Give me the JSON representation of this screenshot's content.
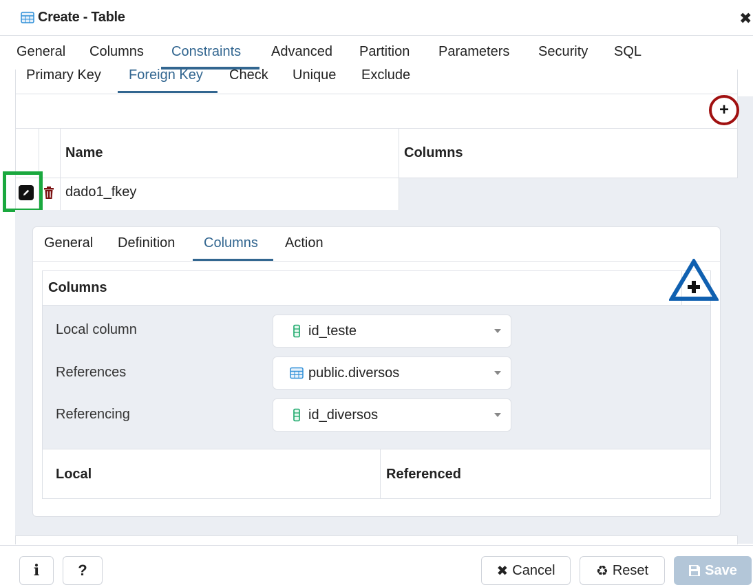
{
  "window": {
    "title": "Create - Table",
    "close_glyph": "✖"
  },
  "main_tabs": [
    {
      "label": "General"
    },
    {
      "label": "Columns"
    },
    {
      "label": "Constraints",
      "active": true
    },
    {
      "label": "Advanced"
    },
    {
      "label": "Partition"
    },
    {
      "label": "Parameters"
    },
    {
      "label": "Security"
    },
    {
      "label": "SQL"
    }
  ],
  "constraint_tabs": [
    {
      "label": "Primary Key"
    },
    {
      "label": "Foreign Key",
      "active": true
    },
    {
      "label": "Check"
    },
    {
      "label": "Unique"
    },
    {
      "label": "Exclude"
    }
  ],
  "fk_table": {
    "add_glyph": "+",
    "headers": {
      "name": "Name",
      "columns": "Columns"
    },
    "rows": [
      {
        "name": "dado1_fkey",
        "columns": ""
      }
    ]
  },
  "fk_editor": {
    "tabs": [
      {
        "label": "General"
      },
      {
        "label": "Definition"
      },
      {
        "label": "Columns",
        "active": true
      },
      {
        "label": "Action"
      }
    ],
    "columns_section": {
      "title": "Columns",
      "add_glyph": "+",
      "fields": {
        "local_column": {
          "label": "Local column",
          "value": "id_teste",
          "icon": "column-icon"
        },
        "references": {
          "label": "References",
          "value": "public.diversos",
          "icon": "table-icon"
        },
        "referencing": {
          "label": "Referencing",
          "value": "id_diversos",
          "icon": "column-icon"
        }
      },
      "table_headers": {
        "local": "Local",
        "referenced": "Referenced"
      }
    }
  },
  "footer": {
    "info_label": "i",
    "help_label": "?",
    "cancel_label": "Cancel",
    "cancel_glyph": "✖",
    "reset_label": "Reset",
    "reset_glyph": "♻",
    "save_label": "Save",
    "save_enabled": false
  },
  "colors": {
    "accent": "#326690",
    "highlight_red": "#a01010",
    "highlight_green": "#1aa83e",
    "highlight_blue": "#1060b0",
    "save_disabled": "#b3c6d8"
  }
}
